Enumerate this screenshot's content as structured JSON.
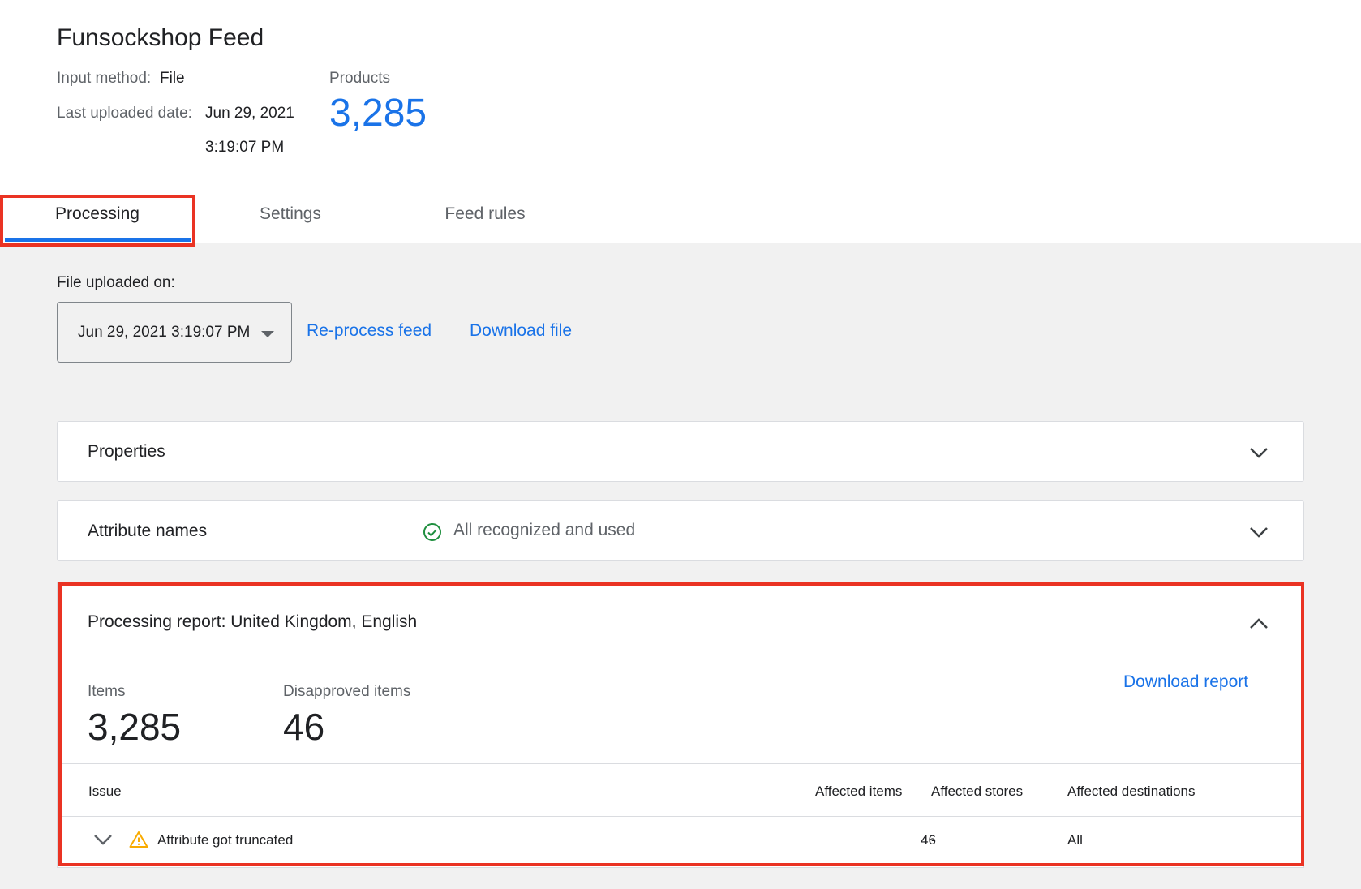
{
  "feed": {
    "title": "Funsockshop Feed",
    "input_method_label": "Input method:",
    "input_method_value": "File",
    "last_uploaded_label": "Last uploaded date:",
    "last_uploaded_date": "Jun 29, 2021",
    "last_uploaded_time": "3:19:07 PM",
    "products_label": "Products",
    "products_value": "3,285"
  },
  "tabs": [
    {
      "label": "Processing",
      "active": true
    },
    {
      "label": "Settings",
      "active": false
    },
    {
      "label": "Feed rules",
      "active": false
    }
  ],
  "upload": {
    "label": "File uploaded on:",
    "selected_value": "Jun 29, 2021 3:19:07 PM",
    "reprocess_link": "Re-process feed",
    "download_link": "Download file"
  },
  "sections": {
    "properties": {
      "title": "Properties"
    },
    "attribute_names": {
      "title": "Attribute names",
      "status": "All recognized and used"
    },
    "processing_report": {
      "title": "Processing report: United Kingdom, English",
      "download_link": "Download report",
      "items_label": "Items",
      "items_value": "3,285",
      "disapproved_label": "Disapproved items",
      "disapproved_value": "46",
      "columns": [
        "Issue",
        "Affected items",
        "Affected stores",
        "Affected destinations"
      ],
      "rows": [
        {
          "issue": "Attribute got truncated",
          "affected_items": "46",
          "affected_stores": "-",
          "affected_destinations": "All"
        }
      ]
    }
  },
  "colors": {
    "accent": "#1a73e8",
    "highlight": "#ea3323",
    "success": "#1e8e3e",
    "warning": "#f9ab00"
  },
  "icons": [
    "chevron-down-icon",
    "chevron-up-icon",
    "check-circle-icon",
    "warning-icon",
    "dropdown-caret-icon"
  ]
}
